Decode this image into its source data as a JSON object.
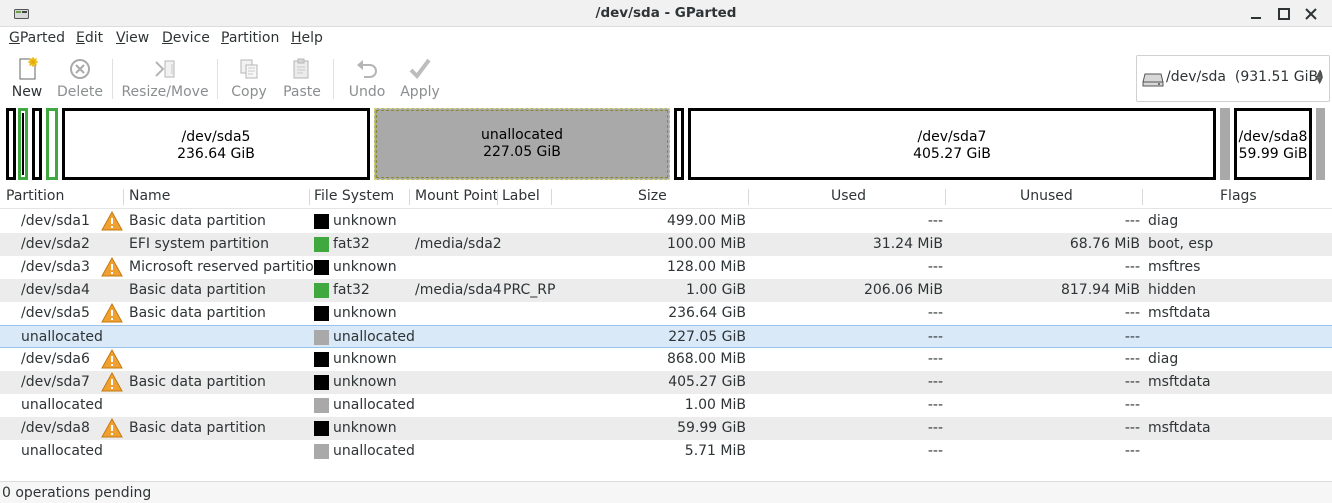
{
  "window": {
    "title": "/dev/sda - GParted"
  },
  "menu": [
    {
      "label": "GParted",
      "accel_index": 0
    },
    {
      "label": "Edit",
      "accel_index": 0
    },
    {
      "label": "View",
      "accel_index": 0
    },
    {
      "label": "Device",
      "accel_index": 0
    },
    {
      "label": "Partition",
      "accel_index": 0
    },
    {
      "label": "Help",
      "accel_index": 0
    }
  ],
  "toolbar": {
    "new": {
      "label": "New",
      "enabled": true
    },
    "delete": {
      "label": "Delete",
      "enabled": false
    },
    "resize": {
      "label": "Resize/Move",
      "enabled": false
    },
    "copy": {
      "label": "Copy",
      "enabled": false
    },
    "paste": {
      "label": "Paste",
      "enabled": false
    },
    "undo": {
      "label": "Undo",
      "enabled": false
    },
    "apply": {
      "label": "Apply",
      "enabled": false
    }
  },
  "device_selector": {
    "device": "/dev/sda",
    "size": "(931.51 GiB)"
  },
  "disk_graph": [
    {
      "name": "",
      "size": "",
      "kind": "tiny-unknown"
    },
    {
      "name": "",
      "size": "",
      "kind": "tiny-fat32"
    },
    {
      "name": "",
      "size": "",
      "kind": "tiny-unknown"
    },
    {
      "name": "",
      "size": "",
      "kind": "tiny-fat32"
    },
    {
      "name": "/dev/sda5",
      "size": "236.64 GiB",
      "kind": "unknown"
    },
    {
      "name": "unallocated",
      "size": "227.05 GiB",
      "kind": "unallocated",
      "selected": true
    },
    {
      "name": "",
      "size": "",
      "kind": "tiny-unknown"
    },
    {
      "name": "/dev/sda7",
      "size": "405.27 GiB",
      "kind": "unknown"
    },
    {
      "name": "",
      "size": "",
      "kind": "tiny-unallocated"
    },
    {
      "name": "/dev/sda8",
      "size": "59.99 GiB",
      "kind": "unknown"
    },
    {
      "name": "",
      "size": "",
      "kind": "tiny-unallocated"
    }
  ],
  "table": {
    "columns": [
      "Partition",
      "Name",
      "File System",
      "Mount Point",
      "Label",
      "Size",
      "Used",
      "Unused",
      "Flags"
    ],
    "rows": [
      {
        "partition": "/dev/sda1",
        "warning": true,
        "name": "Basic data partition",
        "fs": "unknown",
        "fs_color": "#000000",
        "mount": "",
        "label": "",
        "size": "499.00 MiB",
        "used": "---",
        "unused": "---",
        "flags": "diag"
      },
      {
        "partition": "/dev/sda2",
        "warning": false,
        "name": "EFI system partition",
        "fs": "fat32",
        "fs_color": "#3fa83f",
        "mount": "/media/sda2",
        "label": "",
        "size": "100.00 MiB",
        "used": "31.24 MiB",
        "unused": "68.76 MiB",
        "flags": "boot, esp"
      },
      {
        "partition": "/dev/sda3",
        "warning": true,
        "name": "Microsoft reserved partition",
        "fs": "unknown",
        "fs_color": "#000000",
        "mount": "",
        "label": "",
        "size": "128.00 MiB",
        "used": "---",
        "unused": "---",
        "flags": "msftres"
      },
      {
        "partition": "/dev/sda4",
        "warning": false,
        "name": "Basic data partition",
        "fs": "fat32",
        "fs_color": "#3fa83f",
        "mount": "/media/sda4",
        "label": "PRC_RP",
        "size": "1.00 GiB",
        "used": "206.06 MiB",
        "unused": "817.94 MiB",
        "flags": "hidden"
      },
      {
        "partition": "/dev/sda5",
        "warning": true,
        "name": "Basic data partition",
        "fs": "unknown",
        "fs_color": "#000000",
        "mount": "",
        "label": "",
        "size": "236.64 GiB",
        "used": "---",
        "unused": "---",
        "flags": "msftdata"
      },
      {
        "partition": "unallocated",
        "warning": false,
        "name": "",
        "fs": "unallocated",
        "fs_color": "#a9a9a9",
        "mount": "",
        "label": "",
        "size": "227.05 GiB",
        "used": "---",
        "unused": "---",
        "flags": "",
        "selected": true
      },
      {
        "partition": "/dev/sda6",
        "warning": true,
        "name": "",
        "fs": "unknown",
        "fs_color": "#000000",
        "mount": "",
        "label": "",
        "size": "868.00 MiB",
        "used": "---",
        "unused": "---",
        "flags": "diag"
      },
      {
        "partition": "/dev/sda7",
        "warning": true,
        "name": "Basic data partition",
        "fs": "unknown",
        "fs_color": "#000000",
        "mount": "",
        "label": "",
        "size": "405.27 GiB",
        "used": "---",
        "unused": "---",
        "flags": "msftdata"
      },
      {
        "partition": "unallocated",
        "warning": false,
        "name": "",
        "fs": "unallocated",
        "fs_color": "#a9a9a9",
        "mount": "",
        "label": "",
        "size": "1.00 MiB",
        "used": "---",
        "unused": "---",
        "flags": ""
      },
      {
        "partition": "/dev/sda8",
        "warning": true,
        "name": "Basic data partition",
        "fs": "unknown",
        "fs_color": "#000000",
        "mount": "",
        "label": "",
        "size": "59.99 GiB",
        "used": "---",
        "unused": "---",
        "flags": "msftdata"
      },
      {
        "partition": "unallocated",
        "warning": false,
        "name": "",
        "fs": "unallocated",
        "fs_color": "#a9a9a9",
        "mount": "",
        "label": "",
        "size": "5.71 MiB",
        "used": "---",
        "unused": "---",
        "flags": ""
      }
    ]
  },
  "status": {
    "text": "0 operations pending"
  },
  "colors": {
    "selection": "#d9e9f8",
    "warning": "#f0a030",
    "fat32": "#3fa83f",
    "unknown": "#000000",
    "unallocated": "#a9a9a9"
  }
}
